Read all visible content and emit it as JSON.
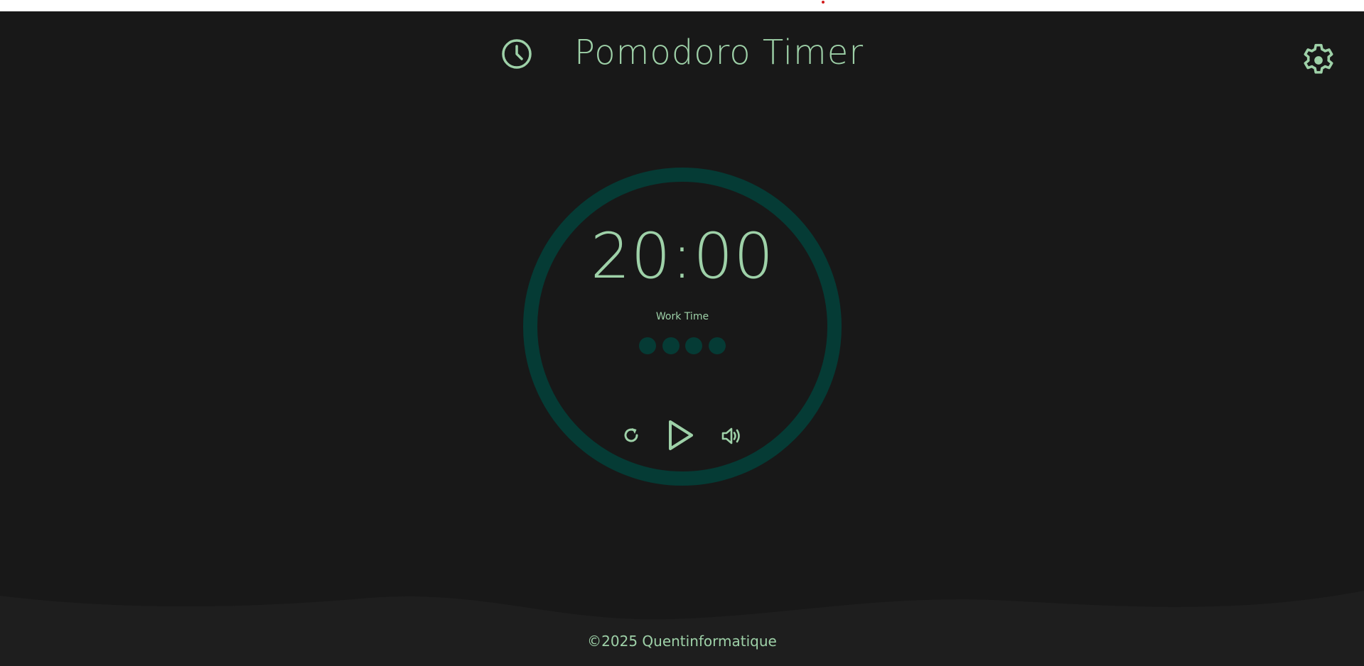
{
  "header": {
    "title": "Pomodoro Timer",
    "history_icon": "clock-icon",
    "settings_icon": "gear-icon"
  },
  "timer": {
    "time": "20:00",
    "session_label": "Work Time",
    "sessions_total": 4,
    "sessions_completed": 0,
    "progress": 0
  },
  "controls": {
    "reset_icon": "reset-icon",
    "play_icon": "play-icon",
    "sound_icon": "volume-icon"
  },
  "footer": {
    "copyright": "©2025 Quentinformatique"
  },
  "colors": {
    "background": "#181818",
    "accent": "#9ed1a8",
    "ring": "#053b35",
    "footer_background": "#1e1e1e"
  }
}
